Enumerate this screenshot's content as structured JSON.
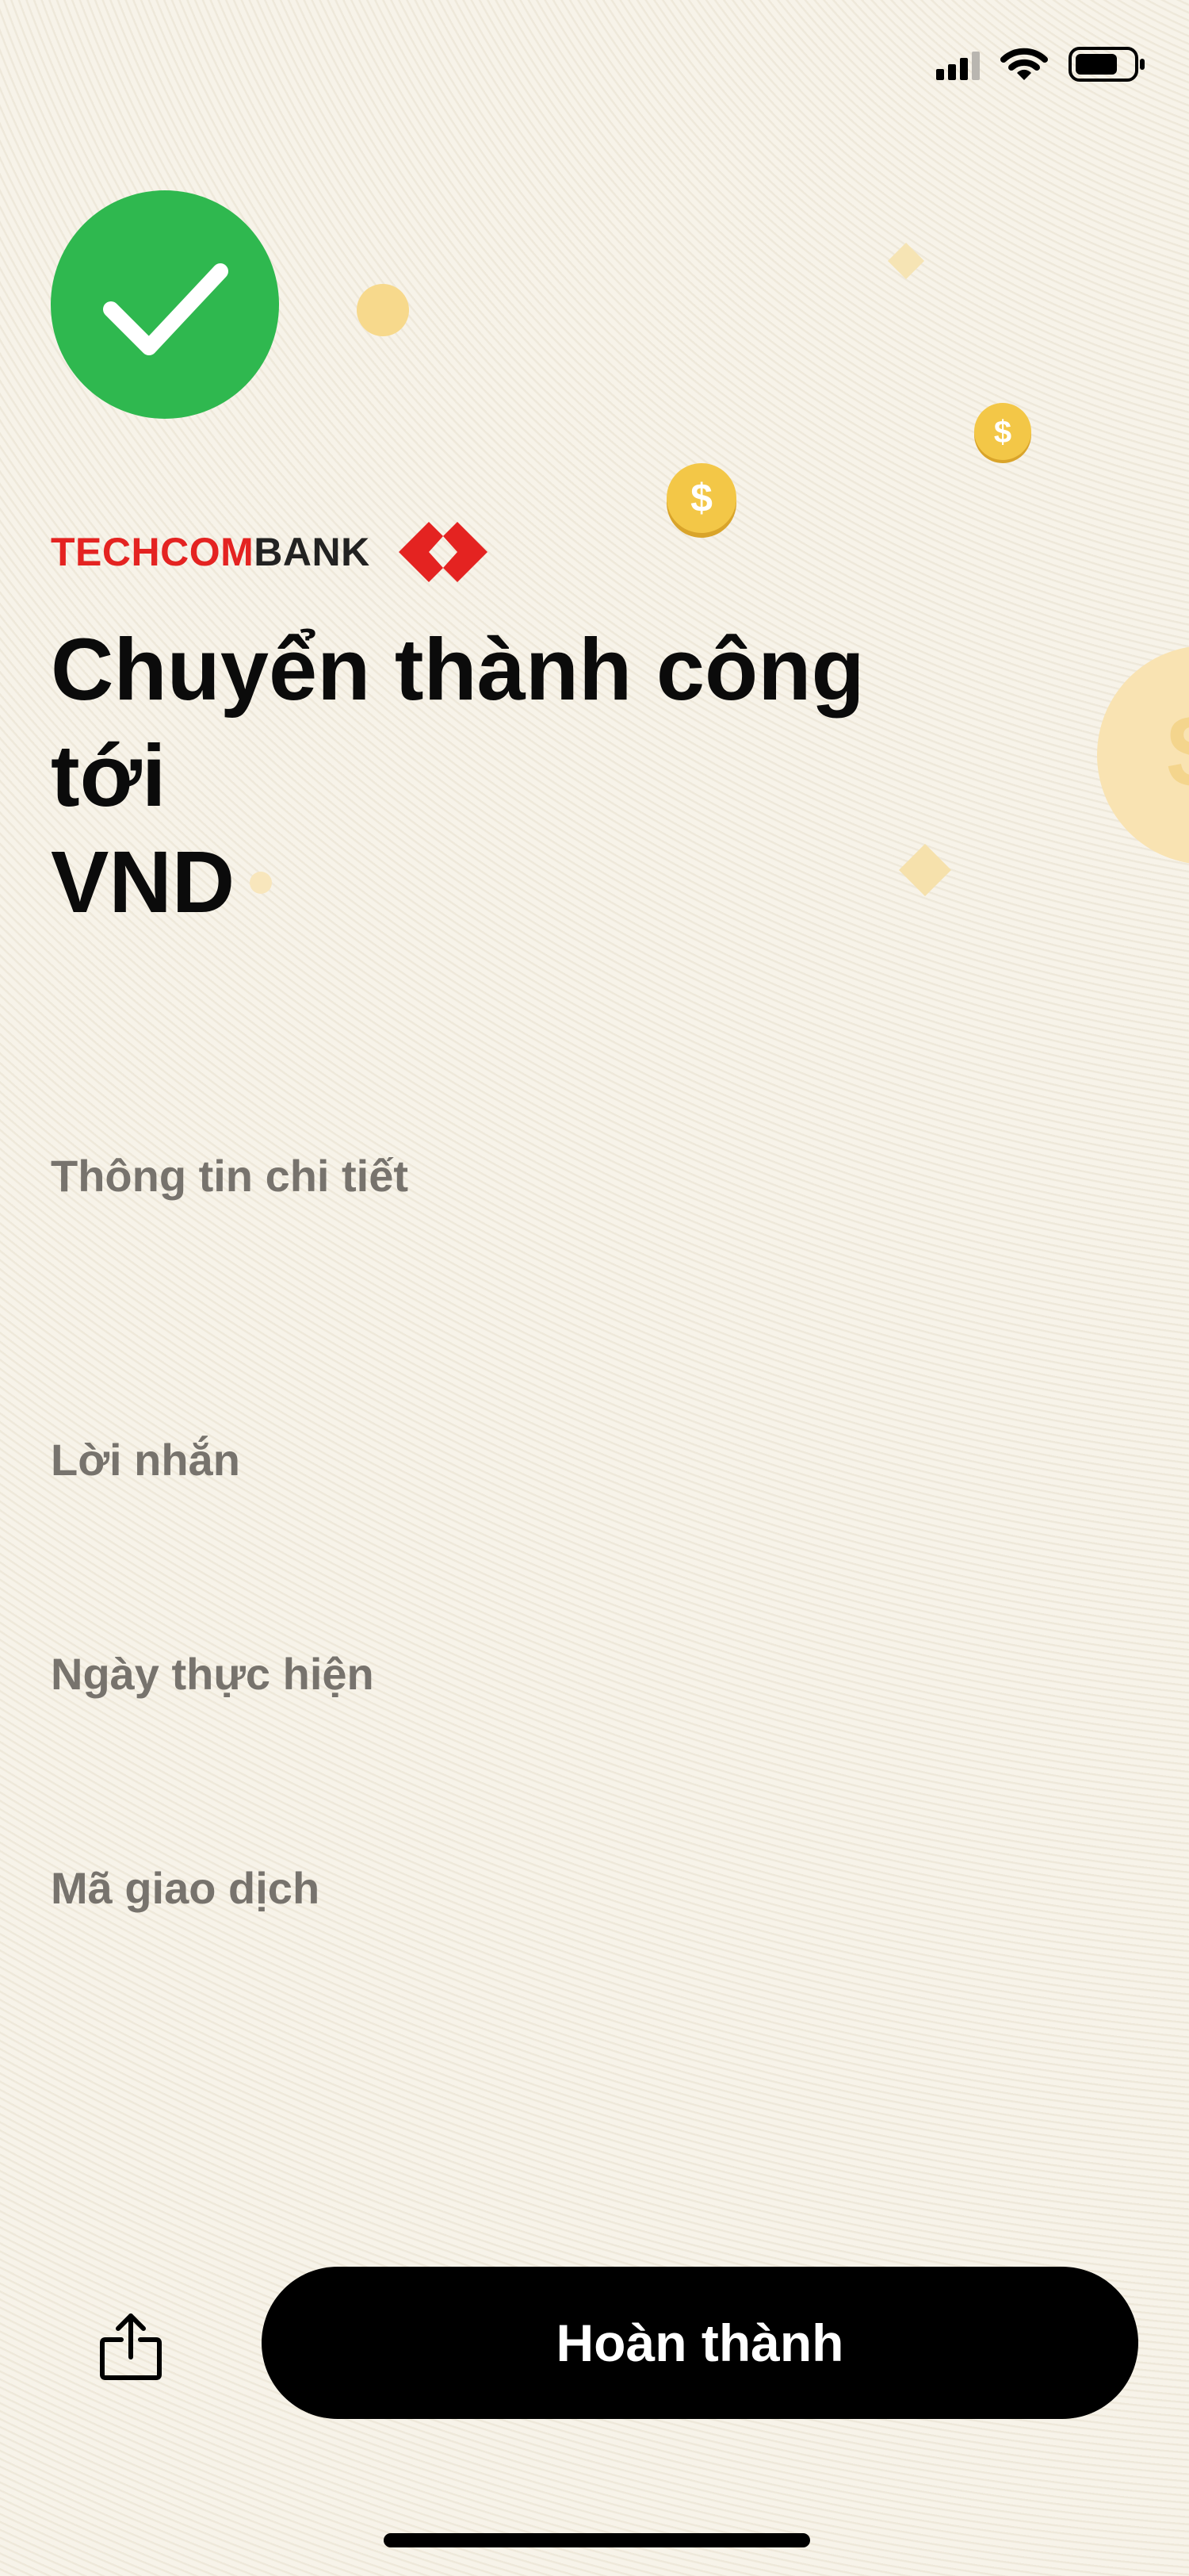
{
  "status_bar": {
    "signal_icon": "cellular-signal-icon",
    "wifi_icon": "wifi-icon",
    "battery_icon": "battery-icon"
  },
  "success": {
    "icon": "checkmark-icon",
    "color": "#2fb84f"
  },
  "brand": {
    "name_red": "TECHCOM",
    "name_black": "BANK",
    "red_color": "#e42321"
  },
  "title": {
    "line1": "Chuyển thành công",
    "line2": "tới",
    "line3": "VND"
  },
  "details": {
    "info_label": "Thông tin chi tiết",
    "message_label": "Lời nhắn",
    "date_label": "Ngày thực hiện",
    "transaction_id_label": "Mã giao dịch"
  },
  "actions": {
    "share_icon": "share-icon",
    "done_label": "Hoàn thành"
  }
}
